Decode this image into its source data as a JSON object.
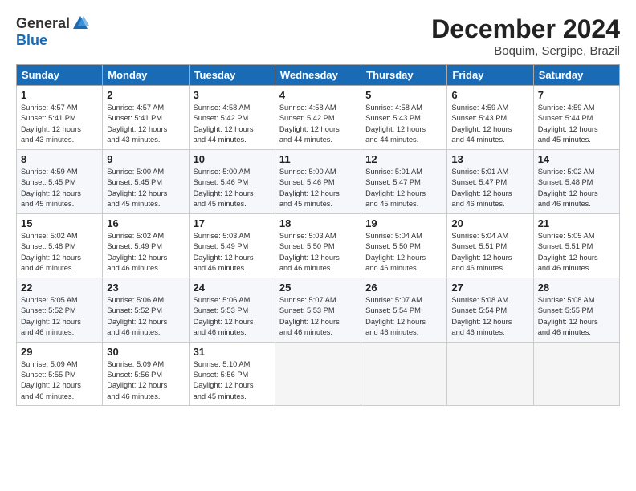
{
  "header": {
    "logo_general": "General",
    "logo_blue": "Blue",
    "title": "December 2024",
    "location": "Boquim, Sergipe, Brazil"
  },
  "columns": [
    "Sunday",
    "Monday",
    "Tuesday",
    "Wednesday",
    "Thursday",
    "Friday",
    "Saturday"
  ],
  "weeks": [
    [
      {
        "day": "1",
        "info": "Sunrise: 4:57 AM\nSunset: 5:41 PM\nDaylight: 12 hours\nand 43 minutes."
      },
      {
        "day": "2",
        "info": "Sunrise: 4:57 AM\nSunset: 5:41 PM\nDaylight: 12 hours\nand 43 minutes."
      },
      {
        "day": "3",
        "info": "Sunrise: 4:58 AM\nSunset: 5:42 PM\nDaylight: 12 hours\nand 44 minutes."
      },
      {
        "day": "4",
        "info": "Sunrise: 4:58 AM\nSunset: 5:42 PM\nDaylight: 12 hours\nand 44 minutes."
      },
      {
        "day": "5",
        "info": "Sunrise: 4:58 AM\nSunset: 5:43 PM\nDaylight: 12 hours\nand 44 minutes."
      },
      {
        "day": "6",
        "info": "Sunrise: 4:59 AM\nSunset: 5:43 PM\nDaylight: 12 hours\nand 44 minutes."
      },
      {
        "day": "7",
        "info": "Sunrise: 4:59 AM\nSunset: 5:44 PM\nDaylight: 12 hours\nand 45 minutes."
      }
    ],
    [
      {
        "day": "8",
        "info": "Sunrise: 4:59 AM\nSunset: 5:45 PM\nDaylight: 12 hours\nand 45 minutes."
      },
      {
        "day": "9",
        "info": "Sunrise: 5:00 AM\nSunset: 5:45 PM\nDaylight: 12 hours\nand 45 minutes."
      },
      {
        "day": "10",
        "info": "Sunrise: 5:00 AM\nSunset: 5:46 PM\nDaylight: 12 hours\nand 45 minutes."
      },
      {
        "day": "11",
        "info": "Sunrise: 5:00 AM\nSunset: 5:46 PM\nDaylight: 12 hours\nand 45 minutes."
      },
      {
        "day": "12",
        "info": "Sunrise: 5:01 AM\nSunset: 5:47 PM\nDaylight: 12 hours\nand 45 minutes."
      },
      {
        "day": "13",
        "info": "Sunrise: 5:01 AM\nSunset: 5:47 PM\nDaylight: 12 hours\nand 46 minutes."
      },
      {
        "day": "14",
        "info": "Sunrise: 5:02 AM\nSunset: 5:48 PM\nDaylight: 12 hours\nand 46 minutes."
      }
    ],
    [
      {
        "day": "15",
        "info": "Sunrise: 5:02 AM\nSunset: 5:48 PM\nDaylight: 12 hours\nand 46 minutes."
      },
      {
        "day": "16",
        "info": "Sunrise: 5:02 AM\nSunset: 5:49 PM\nDaylight: 12 hours\nand 46 minutes."
      },
      {
        "day": "17",
        "info": "Sunrise: 5:03 AM\nSunset: 5:49 PM\nDaylight: 12 hours\nand 46 minutes."
      },
      {
        "day": "18",
        "info": "Sunrise: 5:03 AM\nSunset: 5:50 PM\nDaylight: 12 hours\nand 46 minutes."
      },
      {
        "day": "19",
        "info": "Sunrise: 5:04 AM\nSunset: 5:50 PM\nDaylight: 12 hours\nand 46 minutes."
      },
      {
        "day": "20",
        "info": "Sunrise: 5:04 AM\nSunset: 5:51 PM\nDaylight: 12 hours\nand 46 minutes."
      },
      {
        "day": "21",
        "info": "Sunrise: 5:05 AM\nSunset: 5:51 PM\nDaylight: 12 hours\nand 46 minutes."
      }
    ],
    [
      {
        "day": "22",
        "info": "Sunrise: 5:05 AM\nSunset: 5:52 PM\nDaylight: 12 hours\nand 46 minutes."
      },
      {
        "day": "23",
        "info": "Sunrise: 5:06 AM\nSunset: 5:52 PM\nDaylight: 12 hours\nand 46 minutes."
      },
      {
        "day": "24",
        "info": "Sunrise: 5:06 AM\nSunset: 5:53 PM\nDaylight: 12 hours\nand 46 minutes."
      },
      {
        "day": "25",
        "info": "Sunrise: 5:07 AM\nSunset: 5:53 PM\nDaylight: 12 hours\nand 46 minutes."
      },
      {
        "day": "26",
        "info": "Sunrise: 5:07 AM\nSunset: 5:54 PM\nDaylight: 12 hours\nand 46 minutes."
      },
      {
        "day": "27",
        "info": "Sunrise: 5:08 AM\nSunset: 5:54 PM\nDaylight: 12 hours\nand 46 minutes."
      },
      {
        "day": "28",
        "info": "Sunrise: 5:08 AM\nSunset: 5:55 PM\nDaylight: 12 hours\nand 46 minutes."
      }
    ],
    [
      {
        "day": "29",
        "info": "Sunrise: 5:09 AM\nSunset: 5:55 PM\nDaylight: 12 hours\nand 46 minutes."
      },
      {
        "day": "30",
        "info": "Sunrise: 5:09 AM\nSunset: 5:56 PM\nDaylight: 12 hours\nand 46 minutes."
      },
      {
        "day": "31",
        "info": "Sunrise: 5:10 AM\nSunset: 5:56 PM\nDaylight: 12 hours\nand 45 minutes."
      },
      {
        "day": "",
        "info": ""
      },
      {
        "day": "",
        "info": ""
      },
      {
        "day": "",
        "info": ""
      },
      {
        "day": "",
        "info": ""
      }
    ]
  ]
}
